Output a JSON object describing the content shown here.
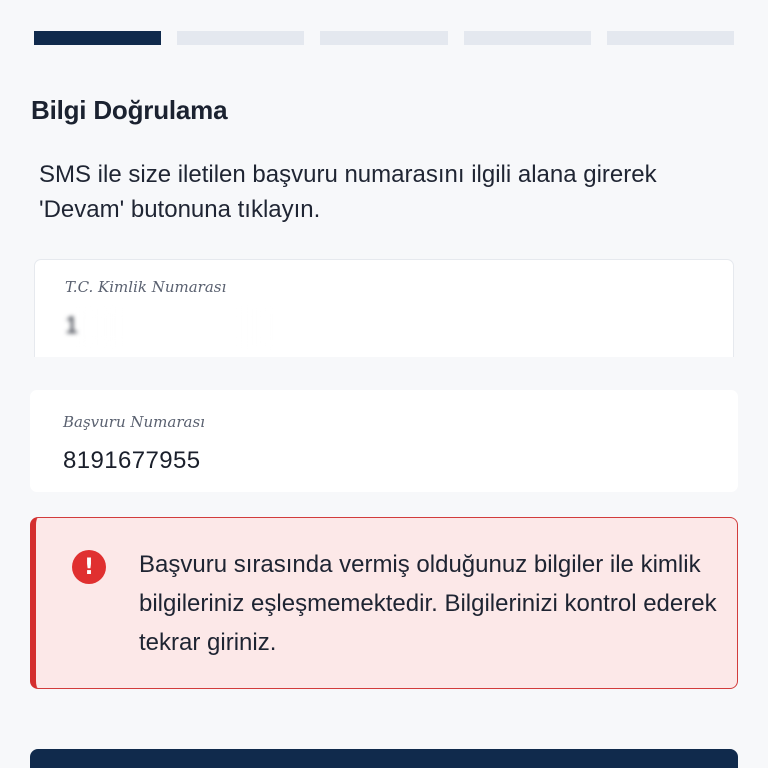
{
  "progress": {
    "total_steps": 5,
    "current_step": 1,
    "active_color": "#102a4c",
    "inactive_color": "#e4e8ef"
  },
  "header": {
    "title": "Bilgi Doğrulama"
  },
  "instructions": {
    "text": "SMS ile size iletilen başvuru numarasını ilgili alana girerek 'Devam' butonuna tıklayın."
  },
  "form": {
    "tc_field": {
      "label": "T.C. Kimlik Numarası",
      "value": "1"
    },
    "application_field": {
      "label": "Başvuru Numarası",
      "value": "8191677955"
    }
  },
  "alert": {
    "icon": "exclamation-circle-icon",
    "icon_glyph": "!",
    "message": "Başvuru sırasında vermiş olduğunuz bilgiler ile kimlik bilgileriniz eşleşmemektedir. Bilgilerinizi kontrol ederek tekrar giriniz.",
    "color": "#d42f2f",
    "background": "#fce8e8"
  }
}
